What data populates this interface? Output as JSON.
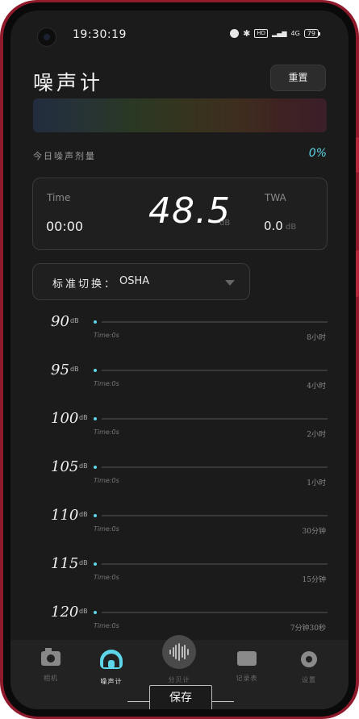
{
  "status_bar": {
    "time": "19:30:19",
    "network": "4G",
    "hd": "HD",
    "battery": "79"
  },
  "header": {
    "title": "噪声计",
    "reset_label": "重置"
  },
  "dose": {
    "label": "今日噪声剂量",
    "value": "0%"
  },
  "meter": {
    "time_label": "Time",
    "time_value": "00:00",
    "db_value": "48.5",
    "db_unit": "dB",
    "twa_label": "TWA",
    "twa_value": "0.0",
    "twa_unit": "dB"
  },
  "standard": {
    "label": "标准切换",
    "separator": "：",
    "value": "OSHA"
  },
  "levels": [
    {
      "level": "90",
      "unit": "dB",
      "time": "Time:0s",
      "limit": "8小时"
    },
    {
      "level": "95",
      "unit": "dB",
      "time": "Time:0s",
      "limit": "4小时"
    },
    {
      "level": "100",
      "unit": "dB",
      "time": "Time:0s",
      "limit": "2小时"
    },
    {
      "level": "105",
      "unit": "dB",
      "time": "Time:0s",
      "limit": "1小时"
    },
    {
      "level": "110",
      "unit": "dB",
      "time": "Time:0s",
      "limit": "30分钟"
    },
    {
      "level": "115",
      "unit": "dB",
      "time": "Time:0s",
      "limit": "15分钟"
    },
    {
      "level": "120",
      "unit": "dB",
      "time": "Time:0s",
      "limit": "7分钟30秒"
    }
  ],
  "tabs": [
    {
      "label": "相机",
      "icon": "camera-icon"
    },
    {
      "label": "噪声计",
      "icon": "ear-icon"
    },
    {
      "label": "分贝计",
      "icon": "waveform-icon"
    },
    {
      "label": "记录表",
      "icon": "record-icon"
    },
    {
      "label": "设置",
      "icon": "gear-icon"
    }
  ],
  "save_label": "保存",
  "colors": {
    "accent": "#5cd6e8",
    "background": "#1b1b1b",
    "frame": "#8f1a2c"
  }
}
